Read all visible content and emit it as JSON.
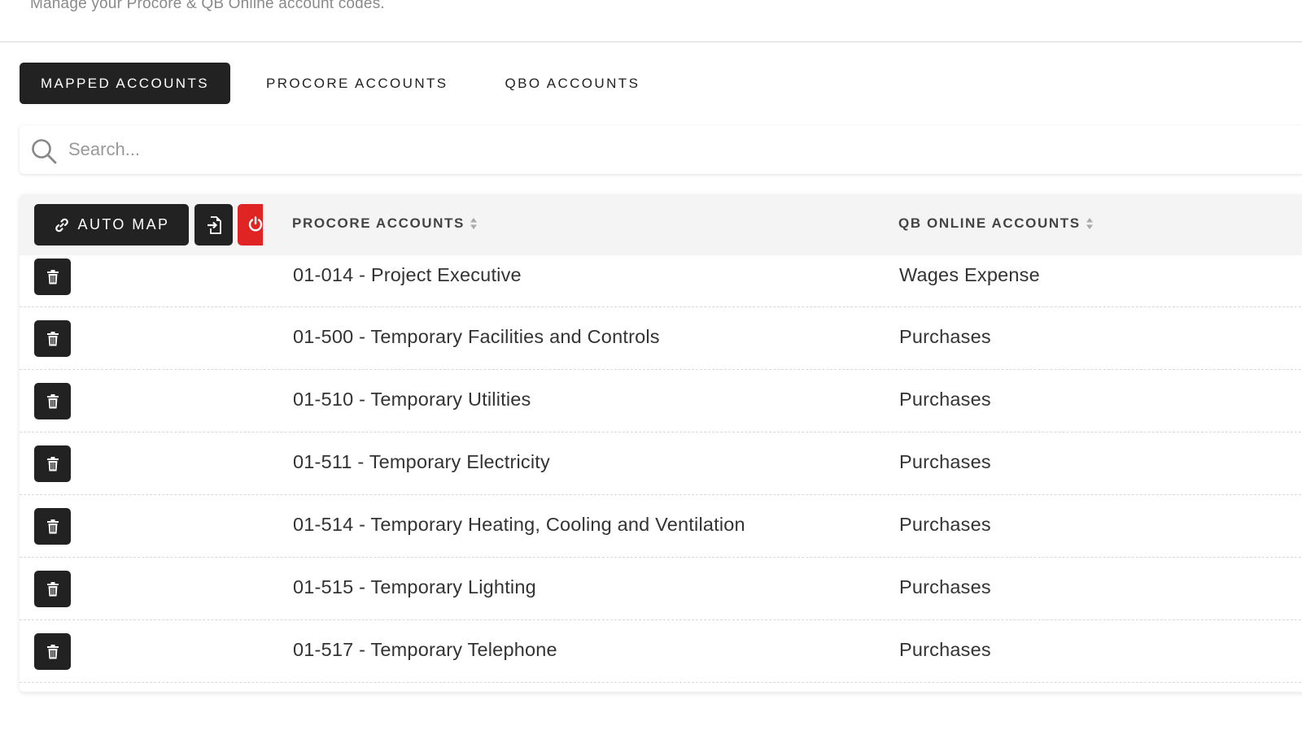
{
  "header": {
    "subtitle": "Manage your Procore & QB Online account codes."
  },
  "tabs": [
    {
      "label": "MAPPED ACCOUNTS",
      "active": true
    },
    {
      "label": "PROCORE ACCOUNTS",
      "active": false
    },
    {
      "label": "QBO ACCOUNTS",
      "active": false
    }
  ],
  "search": {
    "placeholder": "Search...",
    "value": "",
    "icon": "search-icon"
  },
  "table": {
    "toolbar": {
      "automap_label": "AUTO MAP",
      "automap_icon": "link-icon",
      "export_icon": "file-import-icon",
      "power_icon": "power-icon",
      "power_color": "#e02424"
    },
    "columns": [
      "PROCORE ACCOUNTS",
      "QB ONLINE ACCOUNTS"
    ],
    "rows": [
      {
        "procore": "01-014 - Project Executive",
        "qbo": "Wages Expense"
      },
      {
        "procore": "01-500 - Temporary Facilities and Controls",
        "qbo": "Purchases"
      },
      {
        "procore": "01-510 - Temporary Utilities",
        "qbo": "Purchases"
      },
      {
        "procore": "01-511 - Temporary Electricity",
        "qbo": "Purchases"
      },
      {
        "procore": "01-514 - Temporary Heating, Cooling and Ventilation",
        "qbo": "Purchases"
      },
      {
        "procore": "01-515 - Temporary Lighting",
        "qbo": "Purchases"
      },
      {
        "procore": "01-517 - Temporary Telephone",
        "qbo": "Purchases"
      }
    ]
  },
  "colors": {
    "dark": "#222222",
    "header_bg": "#f4f4f4",
    "danger": "#e02424"
  }
}
